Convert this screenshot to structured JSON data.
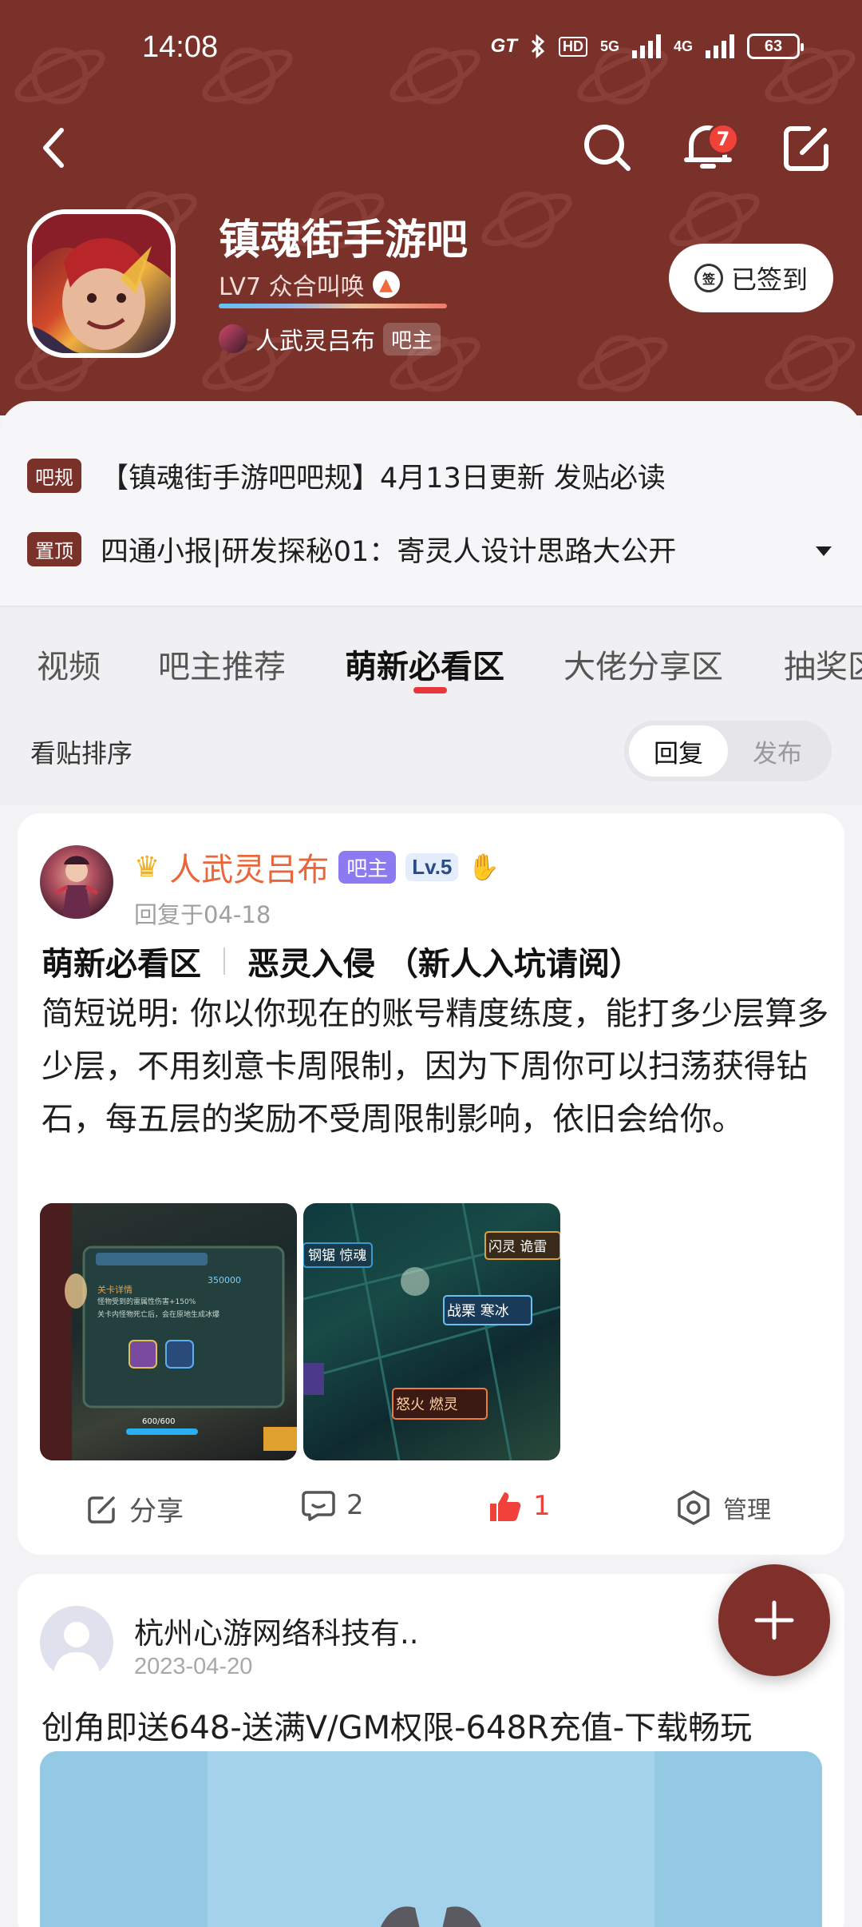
{
  "status_bar": {
    "time": "14:08",
    "indicators": "HD",
    "net1": "5G",
    "net2": "4G",
    "battery": "63"
  },
  "nav": {
    "notification_count": "7"
  },
  "forum": {
    "name": "镇魂街手游吧",
    "level": "LV7 众合叫唤",
    "owner_name": "人武灵吕布",
    "owner_tag": "吧主",
    "signin_label": "已签到",
    "signin_icon_text": "签"
  },
  "notices": [
    {
      "tag": "吧规",
      "text": "【镇魂街手游吧吧规】4月13日更新 发贴必读"
    },
    {
      "tag": "置顶",
      "text": "四通小报|研发探秘01：寄灵人设计思路大公开"
    }
  ],
  "tabs": [
    "视频",
    "吧主推荐",
    "萌新必看区",
    "大佬分享区",
    "抽奖区"
  ],
  "active_tab": "萌新必看区",
  "sort": {
    "label": "看贴排序",
    "options": [
      "回复",
      "发布"
    ],
    "selected": "回复"
  },
  "post1": {
    "author": "人武灵吕布",
    "owner_badge": "吧主",
    "level_badge": "Lv.5",
    "time": "回复于04-18",
    "category": "萌新必看区",
    "title": "恶灵入侵 （新人入坑请阅）",
    "body": "简短说明: 你以你现在的账号精度练度，能打多少层算多少层，不用刻意卡周限制，因为下周你可以扫荡获得钻石，每五层的奖励不受周限制影响，依旧会给你。",
    "thumb1_text": {
      "hp": "600/600",
      "bonus": "怪物受到的雷属性伤害+150%",
      "rule": "关卡内怪物死亡后，会在原地生成冰爆",
      "diamonds": "350000"
    },
    "thumb2_labels": [
      "闪灵 诡雷",
      "钢锯 惊魂",
      "战栗 寒冰",
      "怒火 燃灵"
    ],
    "share_label": "分享",
    "comment_count": "2",
    "like_count": "1",
    "manage_label": "管理"
  },
  "post2": {
    "author": "杭州心游网络科技有..",
    "date": "2023-04-20",
    "title": "创角即送648-送满V/GM权限-648R充值-下载畅玩"
  },
  "colors": {
    "header_bg": "#7a312a",
    "accent_red": "#e8373a",
    "author_orange": "#e8663a",
    "owner_badge": "#8c7bf0"
  }
}
